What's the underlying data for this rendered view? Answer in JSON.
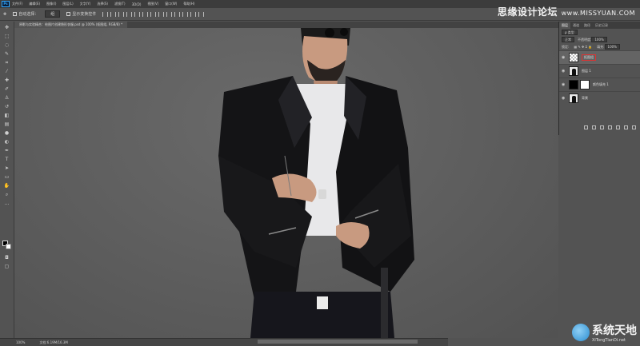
{
  "app": {
    "logo_text": "Ps"
  },
  "menu": [
    "文件(F)",
    "编辑(E)",
    "图像(I)",
    "图层(L)",
    "文字(Y)",
    "选择(S)",
    "滤镜(T)",
    "3D(D)",
    "视图(V)",
    "窗口(W)",
    "帮助(H)"
  ],
  "options": {
    "auto_select_label": "自动选择：",
    "auto_select_value": "组",
    "transform_label": "显示变换控件"
  },
  "watermark_top": {
    "title": "思缘设计论坛",
    "url": "www.MISSYUAN.COM"
  },
  "document_tab": "原影与实验精合：绘图片创建隐形衣服.psd @ 100% (抠图组, RGB/8) *",
  "tools": [
    "move-icon",
    "marquee-icon",
    "lasso-icon",
    "quick-select-icon",
    "crop-icon",
    "eyedropper-icon",
    "healing-icon",
    "brush-icon",
    "stamp-icon",
    "history-brush-icon",
    "eraser-icon",
    "gradient-icon",
    "blur-icon",
    "dodge-icon",
    "pen-icon",
    "type-icon",
    "path-select-icon",
    "shape-icon",
    "hand-icon",
    "zoom-icon",
    "more-icon"
  ],
  "status": {
    "zoom": "100%",
    "doc_info": "文档:6.19M/16.3M"
  },
  "layers_panel": {
    "tabs": [
      "图层",
      "通道",
      "路径",
      "历史记录"
    ],
    "filter_label": "ρ 类型",
    "blend_mode": "正常",
    "opacity_label": "不透明度:",
    "opacity_value": "100%",
    "lock_label": "锁定:",
    "fill_label": "填充:",
    "fill_value": "100%",
    "layers": [
      {
        "name": "抠图组",
        "thumb": "check",
        "selected": true
      },
      {
        "name": "图层 1",
        "thumb": "man",
        "selected": false
      },
      {
        "name": "颜色填充 1",
        "thumb": "black",
        "selected": false
      },
      {
        "name": "背景",
        "thumb": "man",
        "selected": false
      }
    ]
  },
  "watermark_bottom": {
    "text": "系统天地",
    "sub": "XiTongTianDi.net"
  },
  "colors": {
    "accent": "#31a8ff",
    "selection_box": "#dd3333"
  }
}
